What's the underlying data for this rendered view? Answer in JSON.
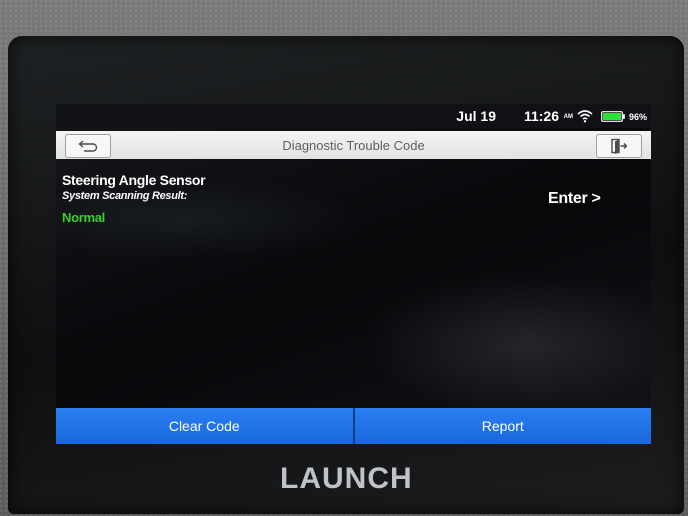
{
  "status_bar": {
    "date": "Jul 19",
    "time": "11:26",
    "ampm": "AM",
    "battery": "96%",
    "icons": [
      "wifi-icon",
      "battery-icon"
    ]
  },
  "header": {
    "title": "Diagnostic Trouble Code",
    "back_icon": "back-arrow-icon",
    "exit_icon": "exit-door-icon"
  },
  "result": {
    "system_name": "Steering Angle Sensor",
    "label": "System Scanning Result:",
    "value": "Normal",
    "enter_label": "Enter >"
  },
  "actions": {
    "clear_code": "Clear Code",
    "report": "Report"
  },
  "device": {
    "brand": "LAUNCH"
  },
  "colors": {
    "accent_blue": "#2a7ff2",
    "normal_green": "#39d22a",
    "battery_green": "#2ee03a"
  }
}
